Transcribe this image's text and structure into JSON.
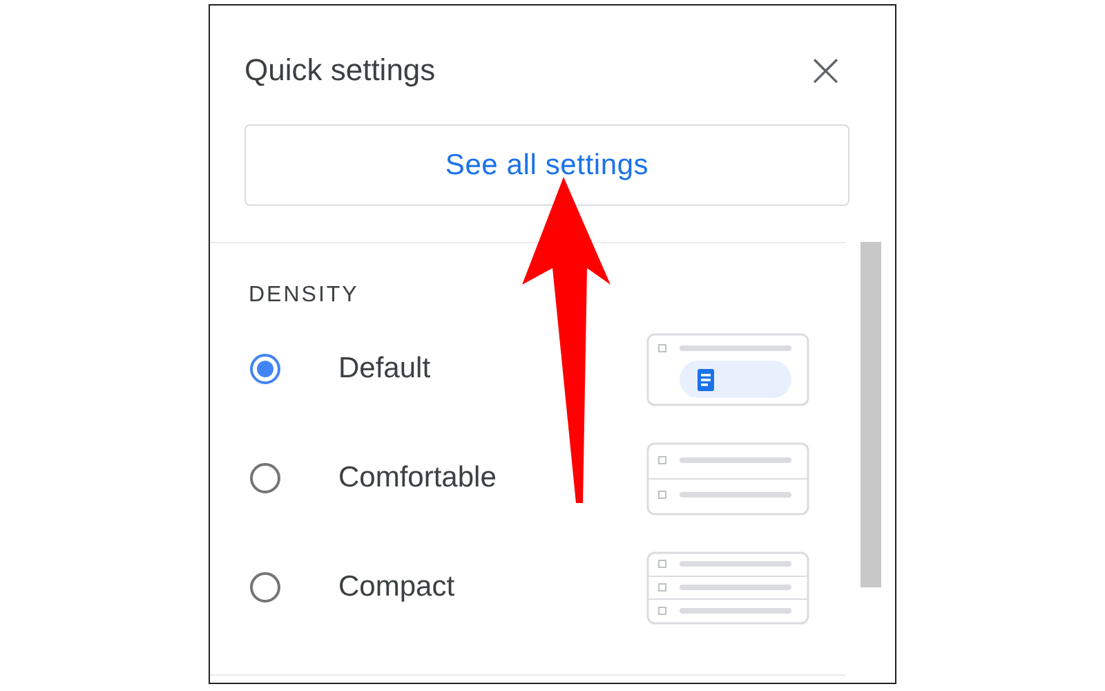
{
  "panel": {
    "title": "Quick settings",
    "close_icon": "×"
  },
  "see_all_button": "See all settings",
  "density": {
    "heading": "DENSITY",
    "options": [
      {
        "label": "Default",
        "selected": true,
        "kind": "default"
      },
      {
        "label": "Comfortable",
        "selected": false,
        "kind": "comfortable"
      },
      {
        "label": "Compact",
        "selected": false,
        "kind": "compact"
      }
    ]
  }
}
